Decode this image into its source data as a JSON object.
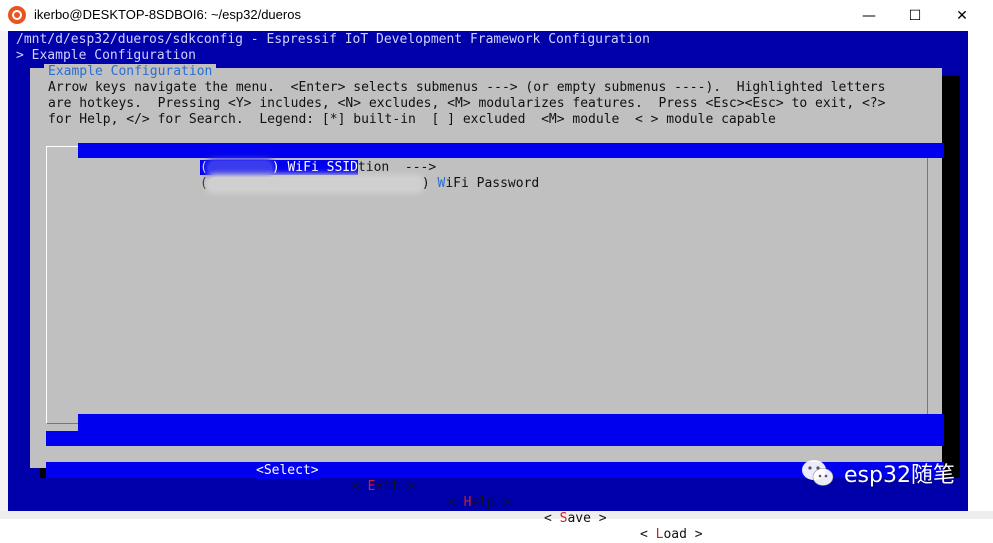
{
  "window": {
    "title": "ikerbo@DESKTOP-8SDBOI6: ~/esp32/dueros",
    "minimize_glyph": "—",
    "maximize_glyph": "☐",
    "close_glyph": "✕",
    "icon": "ubuntu-icon"
  },
  "terminal": {
    "path_line": "/mnt/d/esp32/dueros/sdkconfig - Espressif IoT Development Framework Configuration",
    "breadcrumb_line": "> Example Configuration",
    "colors": {
      "background": "#0000aa",
      "highlight": "#0000ee",
      "dialog": "#c0c0c0"
    }
  },
  "dialog": {
    "title": "Example Configuration",
    "help_lines": [
      "Arrow keys navigate the menu.  <Enter> selects submenus ---> (or empty submenus ----).  Highlighted letters",
      "are hotkeys.  Pressing <Y> includes, <N> excludes, <M> modularizes features.  Press <Esc><Esc> to exit, <?>",
      "for Help, </> for Search.  Legend: [*] built-in  [ ] excluded  <M> module  < > module capable"
    ],
    "menu_items": [
      {
        "prefix": "(",
        "suffix": ") WiFi SSID",
        "tail": "tion  --->",
        "selected": true
      },
      {
        "prefix": "(",
        "suffix": ") ",
        "hotkey": "W",
        "rest": "iFi Password",
        "selected": false
      }
    ],
    "buttons": [
      {
        "left": "<",
        "label": "Select",
        "right": ">",
        "active": true
      },
      {
        "left": "< ",
        "hot": "E",
        "label": "xit",
        "right": " >",
        "active": false
      },
      {
        "left": "< ",
        "hot": "H",
        "label": "elp",
        "right": " >",
        "active": false
      },
      {
        "left": "< ",
        "hot": "S",
        "label": "ave",
        "right": " >",
        "active": false
      },
      {
        "left": "< ",
        "hot": "L",
        "label": "oad",
        "right": " >",
        "active": false
      }
    ]
  },
  "watermark": {
    "text": "esp32随笔",
    "icon": "wechat-icon"
  }
}
